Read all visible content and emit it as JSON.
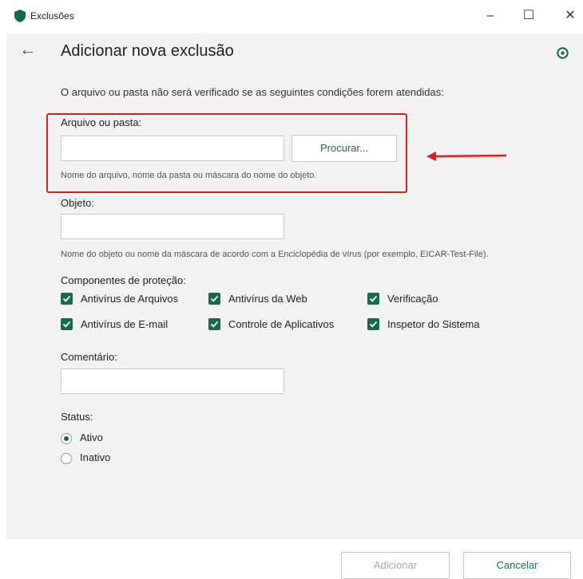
{
  "window": {
    "title": "Exclusões",
    "minimize": "–",
    "maximize": "☐",
    "close": "✕"
  },
  "header": {
    "back": "←",
    "title": "Adicionar nova exclusão"
  },
  "intro": "O arquivo ou pasta não será verificado se as seguintes condições forem atendidas:",
  "file": {
    "label": "Arquivo ou pasta:",
    "value": "",
    "browse_label": "Procurar...",
    "hint": "Nome do arquivo, nome da pasta ou máscara do nome do objeto."
  },
  "object": {
    "label": "Objeto:",
    "value": "",
    "hint": "Nome do objeto ou nome da máscara de acordo com a Enciclopédia de vírus (por exemplo, EICAR-Test-File)."
  },
  "components": {
    "label": "Componentes de proteção:",
    "items": [
      {
        "label": "Antivírus de Arquivos",
        "checked": true
      },
      {
        "label": "Antivírus da Web",
        "checked": true
      },
      {
        "label": "Verificação",
        "checked": true
      },
      {
        "label": "Antivírus de E-mail",
        "checked": true
      },
      {
        "label": "Controle de Aplicativos",
        "checked": true
      },
      {
        "label": "Inspetor do Sistema",
        "checked": true
      }
    ]
  },
  "comment": {
    "label": "Comentário:",
    "value": ""
  },
  "status": {
    "label": "Status:",
    "options": [
      {
        "label": "Ativo",
        "selected": true
      },
      {
        "label": "Inativo",
        "selected": false
      }
    ]
  },
  "footer": {
    "add_label": "Adicionar",
    "cancel_label": "Cancelar"
  },
  "colors": {
    "accent": "#15694f",
    "annotation_red": "#e02020",
    "panel_bg": "#f2f2f2"
  }
}
